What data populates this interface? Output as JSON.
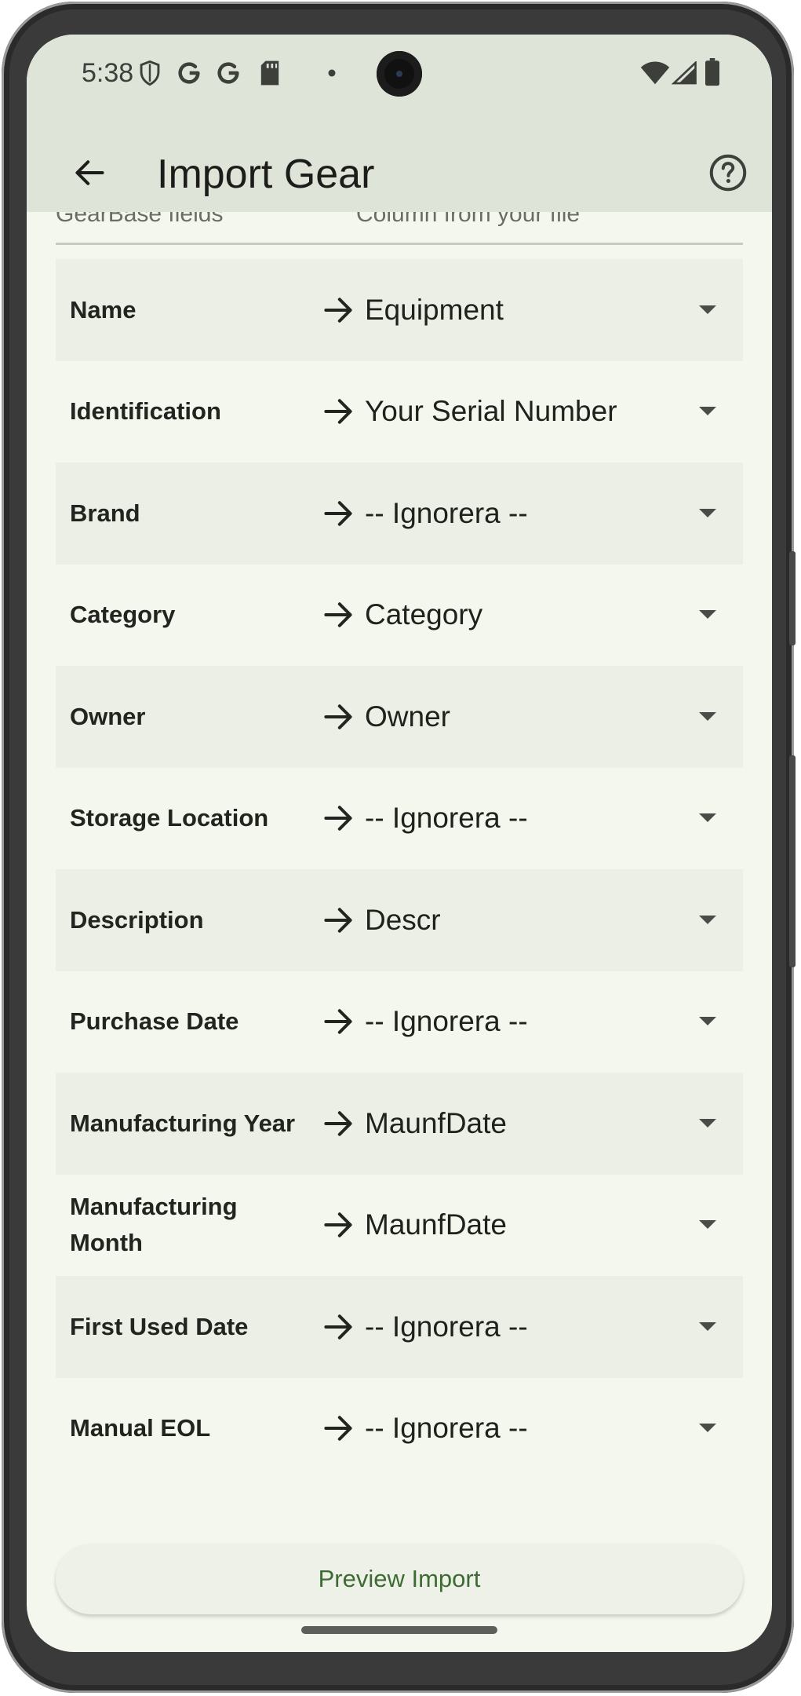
{
  "status_bar": {
    "time": "5:38"
  },
  "app_bar": {
    "title": "Import Gear"
  },
  "columns": {
    "left_header": "GearBase fields",
    "right_header": "Column from your file"
  },
  "mappings": [
    {
      "field": "Name",
      "value": "Equipment"
    },
    {
      "field": "Identification",
      "value": "Your Serial Number"
    },
    {
      "field": "Brand",
      "value": "-- Ignorera --"
    },
    {
      "field": "Category",
      "value": "Category"
    },
    {
      "field": "Owner",
      "value": "Owner"
    },
    {
      "field": "Storage Location",
      "value": "-- Ignorera --"
    },
    {
      "field": "Description",
      "value": "Descr"
    },
    {
      "field": "Purchase Date",
      "value": "-- Ignorera --"
    },
    {
      "field": "Manufacturing Year",
      "value": "MaunfDate"
    },
    {
      "field": "Manufacturing Month",
      "value": "MaunfDate"
    },
    {
      "field": "First Used Date",
      "value": "-- Ignorera --"
    },
    {
      "field": "Manual EOL",
      "value": "-- Ignorera --"
    }
  ],
  "actions": {
    "preview_label": "Preview Import"
  },
  "colors": {
    "accent": "#3d6b33",
    "app_bar_bg": "#dfe4d9",
    "screen_bg": "#f4f7ee",
    "row_alt_bg": "#ecefe6"
  },
  "icons": {
    "back": "arrow-left-icon",
    "help": "help-circle-icon",
    "row_arrow": "arrow-right-icon",
    "dropdown": "caret-down-icon"
  }
}
